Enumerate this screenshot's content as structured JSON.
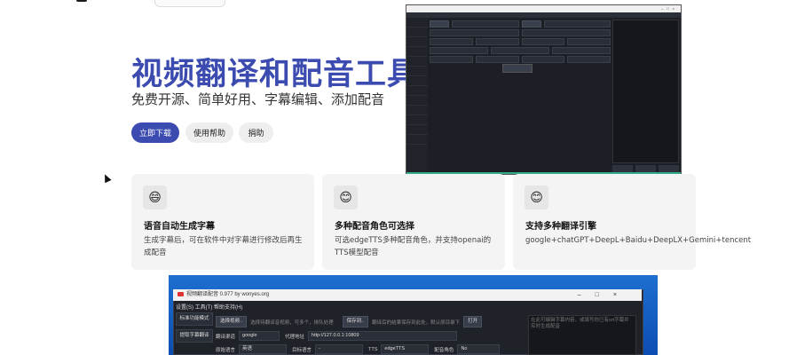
{
  "hero": {
    "title": "视频翻译和配音工具",
    "subtitle": "免费开源、简单好用、字幕编辑、添加配音",
    "buttons": {
      "download": "立即下载",
      "help": "使用帮助",
      "donate": "捐助"
    }
  },
  "features": [
    {
      "icon": "grinning-face-emoji",
      "title": "语音自动生成字幕",
      "desc": "生成字幕后，可在软件中对字幕进行修改后再生成配音"
    },
    {
      "icon": "smiling-face-emoji",
      "title": "多种配音角色可选择",
      "desc": "可选edgeTTS多种配音角色，并支持openai的TTS模型配音"
    },
    {
      "icon": "smiling-face-emoji",
      "title": "支持多种翻译引擎",
      "desc": "google+chatGPT+DeepL+Baidu+DeepLX+Gemini+tencent"
    }
  ],
  "app_bottom": {
    "window_title": "视频翻译配音 0.977 by wonyes.org",
    "menu": "设置(S)  工具(T)  帮助支持(H)",
    "side": [
      "标准功能模式",
      "提取字幕翻译"
    ],
    "select_video": "选择视频..",
    "select_video_hint": "选择待翻译音视频，可多个，排队处理",
    "save_to": "保存到..",
    "save_to_hint": "翻译后的结果保存到此处，默认原目录下",
    "open_label": "打开",
    "right_hint": "在此可编辑字幕内容，或填写你已有srt字幕并实时生成配音",
    "translate_channel_label": "翻译渠道",
    "translate_channel_value": "google",
    "proxy_label": "代理地址",
    "proxy_value": "http://127.0.0.1:10809",
    "source_lang_label": "原始语言",
    "source_lang_value": "英语",
    "target_lang_label": "目标语言",
    "target_lang_value": "-",
    "tts_label": "TTS",
    "tts_value": "edgeTTS",
    "voice_label": "配音角色",
    "voice_value": "No"
  },
  "colors": {
    "accent": "#3b4bb0",
    "card_bg": "#f4f4f4",
    "app_bg": "#1f2229",
    "desktop_blue": "#1e6fd0"
  }
}
